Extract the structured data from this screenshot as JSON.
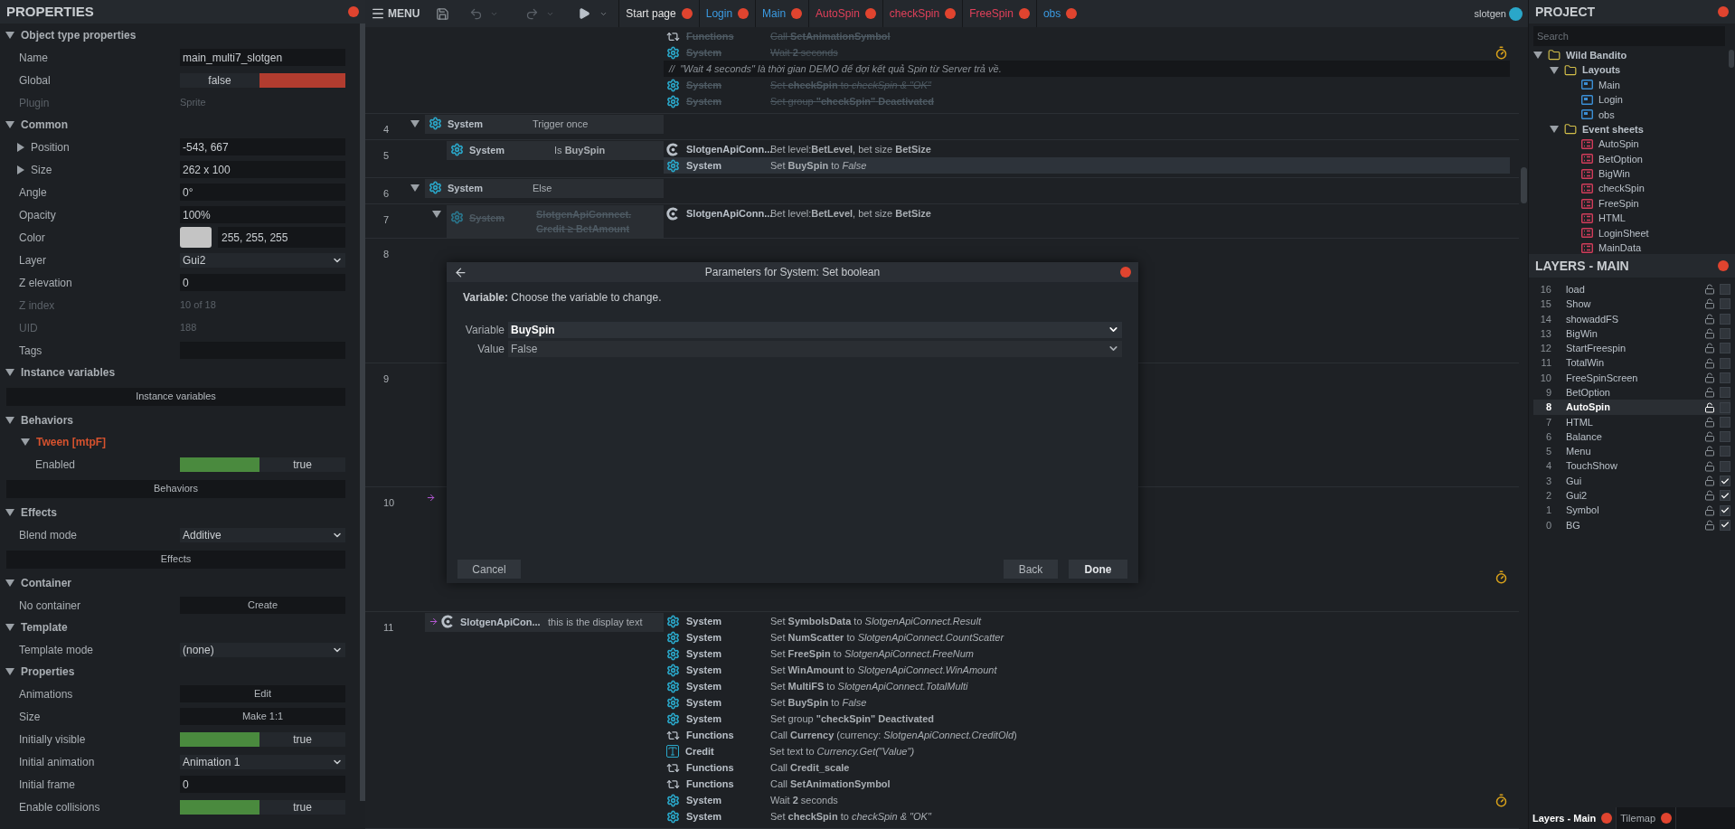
{
  "properties": {
    "title": "PROPERTIES",
    "sections": [
      {
        "title": "Object type properties",
        "expanded": true,
        "rows": [
          {
            "kind": "text",
            "label": "Name",
            "value": "main_multi7_slotgen"
          },
          {
            "kind": "toggle",
            "label": "Global",
            "value": "false",
            "on": false
          },
          {
            "kind": "info",
            "label": "Plugin",
            "value": "Sprite"
          }
        ]
      },
      {
        "title": "Common",
        "expanded": true,
        "rows": [
          {
            "kind": "text",
            "label": "Position",
            "value": "-543, 667",
            "expanded": false
          },
          {
            "kind": "text",
            "label": "Size",
            "value": "262 x 100",
            "expanded": false
          },
          {
            "kind": "text",
            "label": "Angle",
            "value": "0°"
          },
          {
            "kind": "text",
            "label": "Opacity",
            "value": "100%"
          },
          {
            "kind": "color",
            "label": "Color",
            "value": "255, 255, 255"
          },
          {
            "kind": "select",
            "label": "Layer",
            "value": "Gui2"
          },
          {
            "kind": "text",
            "label": "Z elevation",
            "value": "0"
          },
          {
            "kind": "info",
            "label": "Z index",
            "value": "10 of 18"
          },
          {
            "kind": "info",
            "label": "UID",
            "value": "188"
          },
          {
            "kind": "text",
            "label": "Tags"
          }
        ]
      },
      {
        "title": "Instance variables",
        "expanded": true,
        "rows": [
          {
            "kind": "wide_button",
            "label": "Instance variables"
          }
        ]
      },
      {
        "title": "Behaviors",
        "expanded": true,
        "rows": [
          {
            "kind": "behavior",
            "label": "Tween [mtpF]",
            "expanded": true,
            "children": [
              {
                "kind": "toggle",
                "label": "Enabled",
                "value": "true",
                "on": true
              }
            ]
          },
          {
            "kind": "wide_button",
            "label": "Behaviors"
          }
        ]
      },
      {
        "title": "Effects",
        "expanded": true,
        "rows": [
          {
            "kind": "select",
            "label": "Blend mode",
            "value": "Additive"
          },
          {
            "kind": "wide_button",
            "label": "Effects"
          }
        ]
      },
      {
        "title": "Container",
        "expanded": true,
        "rows": [
          {
            "kind": "action",
            "label": "No container",
            "button": "Create"
          }
        ]
      },
      {
        "title": "Template",
        "expanded": true,
        "rows": [
          {
            "kind": "select",
            "label": "Template mode",
            "value": "(none)"
          }
        ]
      },
      {
        "title": "Properties",
        "expanded": true,
        "rows": [
          {
            "kind": "action",
            "label": "Animations",
            "button": "Edit"
          },
          {
            "kind": "action",
            "label": "Size",
            "button": "Make 1:1"
          },
          {
            "kind": "toggle",
            "label": "Initially visible",
            "value": "true",
            "on": true
          },
          {
            "kind": "select",
            "label": "Initial animation",
            "value": "Animation 1"
          },
          {
            "kind": "text",
            "label": "Initial frame",
            "value": "0"
          },
          {
            "kind": "toggle",
            "label": "Enable collisions",
            "value": "true",
            "on": true
          }
        ]
      }
    ]
  },
  "toolbar": {
    "menu": "MENU"
  },
  "tabs": [
    {
      "label": "Start page",
      "color": "#e6e6e6"
    },
    {
      "label": "Login",
      "color": "#3b9ae1"
    },
    {
      "label": "Main",
      "color": "#3b9ae1"
    },
    {
      "label": "AutoSpin",
      "color": "#e0405a"
    },
    {
      "label": "checkSpin",
      "color": "#e0405a"
    },
    {
      "label": "FreeSpin",
      "color": "#e0405a"
    },
    {
      "label": "obs",
      "color": "#3b9ae1"
    }
  ],
  "user": {
    "name": "slotgen"
  },
  "event_sheet": {
    "events": [
      {
        "actions": [
          {
            "kind": "functions",
            "object": "Functions",
            "text": "Call **SetAnimationSymbol**",
            "disabled": true
          },
          {
            "kind": "system",
            "object": "System",
            "text": "Wait **2** seconds",
            "disabled": true,
            "wait": true
          },
          {
            "kind": "comment",
            "marker": "//",
            "text": "\"Wait 4 seconds\" là thời gian DEMO để đợi kết quả Spin từ Server trả về."
          },
          {
            "kind": "system",
            "object": "System",
            "text": "Set **checkSpin** to *checkSpin & \"OK\"*",
            "disabled": true
          },
          {
            "kind": "system",
            "object": "System",
            "text": "Set group **\"checkSpin\"** **Deactivated**",
            "disabled": true
          }
        ]
      },
      {
        "number": "4",
        "expanded": true,
        "conditions": [
          {
            "kind": "system",
            "object": "System",
            "text": "Trigger once",
            "disabled": false
          }
        ],
        "children": [
          {
            "number": "5",
            "conditions": [
              {
                "kind": "system",
                "object": "System",
                "text": "Is **BuySpin**",
                "disabled": false
              }
            ],
            "actions": [
              {
                "kind": "slotgen",
                "object": "SlotgenApiConn...",
                "text": "Bet level:**BetLevel**, bet size **BetSize**",
                "disabled": false,
                "selected": false
              },
              {
                "kind": "system",
                "object": "System",
                "text": "Set **BuySpin** to *False*",
                "disabled": false,
                "selected": true
              }
            ]
          }
        ]
      },
      {
        "number": "6",
        "expanded": true,
        "conditions": [
          {
            "kind": "system",
            "object": "System",
            "text": "Else",
            "disabled": false
          }
        ],
        "children": [
          {
            "number": "7",
            "expanded": true,
            "conditions": [
              {
                "kind": "system",
                "object": "System",
                "text": "SlotgenApiConnect. Credit ≥ BetAmount",
                "disabled": true
              }
            ],
            "actions": [
              {
                "kind": "slotgen",
                "object": "SlotgenApiConn...",
                "text": "Bet level:**BetLevel**, bet size **BetSize**",
                "disabled": false
              }
            ]
          }
        ]
      },
      {
        "number": "8"
      },
      {
        "number": "9"
      },
      {
        "number": "10",
        "trigger": true,
        "wait": true
      },
      {
        "number": "11",
        "trigger": true,
        "conditions": [
          {
            "kind": "slotgen",
            "object": "SlotgenApiCon...",
            "text": "this is the display text",
            "disabled": false
          }
        ],
        "actions": [
          {
            "kind": "system",
            "object": "System",
            "text": "Set **SymbolsData** to *SlotgenApiConnect.Result*",
            "disabled": false
          },
          {
            "kind": "system",
            "object": "System",
            "text": "Set **NumScatter** to *SlotgenApiConnect.CountScatter*",
            "disabled": false
          },
          {
            "kind": "system",
            "object": "System",
            "text": "Set **FreeSpin** to *SlotgenApiConnect.FreeNum*",
            "disabled": false
          },
          {
            "kind": "system",
            "object": "System",
            "text": "Set **WinAmount** to *SlotgenApiConnect.WinAmount*",
            "disabled": false
          },
          {
            "kind": "system",
            "object": "System",
            "text": "Set **MultiFS** to *SlotgenApiConnect.TotalMulti*",
            "disabled": false
          },
          {
            "kind": "system",
            "object": "System",
            "text": "Set **BuySpin** to *False*",
            "disabled": false
          },
          {
            "kind": "system",
            "object": "System",
            "text": "Set group **\"checkSpin\"** **Deactivated**",
            "disabled": false
          },
          {
            "kind": "functions",
            "object": "Functions",
            "text": "Call **Currency** (currency: *SlotgenApiConnect.CreditOld*)",
            "disabled": false
          },
          {
            "kind": "text",
            "object": "Credit",
            "text": "Set text to *Currency.Get(\"Value\")*",
            "disabled": false
          },
          {
            "kind": "functions",
            "object": "Functions",
            "text": "Call **Credit_scale**",
            "disabled": false
          },
          {
            "kind": "functions",
            "object": "Functions",
            "text": "Call **SetAnimationSymbol**",
            "disabled": false
          },
          {
            "kind": "system",
            "object": "System",
            "text": "Wait **2** seconds",
            "disabled": false,
            "wait": true
          },
          {
            "kind": "system",
            "object": "System",
            "text": "Set **checkSpin** to *checkSpin & \"OK\"*",
            "disabled": false
          }
        ]
      }
    ]
  },
  "dialog": {
    "title": "Parameters for System: Set boolean",
    "description": "**Variable:** Choose the variable to change.",
    "fields": [
      {
        "label": "Variable",
        "value": "BuySpin",
        "focused": true
      },
      {
        "label": "Value",
        "value": "False",
        "focused": false
      }
    ],
    "buttons": [
      {
        "label": "Cancel",
        "default": false
      },
      {
        "label": "Back",
        "default": false
      },
      {
        "label": "Done",
        "default": true
      }
    ]
  },
  "project": {
    "title": "PROJECT",
    "search": {
      "placeholder": "Search"
    },
    "tree": [
      {
        "label": "Wild Bandito",
        "kind": "folder",
        "expanded": true,
        "children": [
          {
            "label": "Layouts",
            "kind": "folder",
            "expanded": true,
            "children": [
              {
                "label": "Main",
                "kind": "layout"
              },
              {
                "label": "Login",
                "kind": "layout"
              },
              {
                "label": "obs",
                "kind": "layout"
              }
            ]
          },
          {
            "label": "Event sheets",
            "kind": "folder",
            "expanded": true,
            "children": [
              {
                "label": "AutoSpin",
                "kind": "sheet"
              },
              {
                "label": "BetOption",
                "kind": "sheet"
              },
              {
                "label": "BigWin",
                "kind": "sheet"
              },
              {
                "label": "checkSpin",
                "kind": "sheet"
              },
              {
                "label": "FreeSpin",
                "kind": "sheet"
              },
              {
                "label": "HTML",
                "kind": "sheet"
              },
              {
                "label": "LoginSheet",
                "kind": "sheet"
              },
              {
                "label": "MainData",
                "kind": "sheet"
              }
            ]
          }
        ]
      }
    ]
  },
  "layers": {
    "title": "LAYERS - MAIN",
    "items": [
      {
        "number": "16",
        "label": "load",
        "checked": false,
        "selected": false
      },
      {
        "number": "15",
        "label": "Show",
        "checked": false,
        "selected": false
      },
      {
        "number": "14",
        "label": "showaddFS",
        "checked": false,
        "selected": false
      },
      {
        "number": "13",
        "label": "BigWin",
        "checked": false,
        "selected": false
      },
      {
        "number": "12",
        "label": "StartFreespin",
        "checked": false,
        "selected": false
      },
      {
        "number": "11",
        "label": "TotalWin",
        "checked": false,
        "selected": false
      },
      {
        "number": "10",
        "label": "FreeSpinScreen",
        "checked": false,
        "selected": false
      },
      {
        "number": "9",
        "label": "BetOption",
        "checked": false,
        "selected": false
      },
      {
        "number": "8",
        "label": "AutoSpin",
        "checked": false,
        "selected": true
      },
      {
        "number": "7",
        "label": "HTML",
        "checked": false,
        "selected": false
      },
      {
        "number": "6",
        "label": "Balance",
        "checked": false,
        "selected": false
      },
      {
        "number": "5",
        "label": "Menu",
        "checked": false,
        "selected": false
      },
      {
        "number": "4",
        "label": "TouchShow",
        "checked": false,
        "selected": false
      },
      {
        "number": "3",
        "label": "Gui",
        "checked": true,
        "selected": false
      },
      {
        "number": "2",
        "label": "Gui2",
        "checked": true,
        "selected": false
      },
      {
        "number": "1",
        "label": "Symbol",
        "checked": true,
        "selected": false
      },
      {
        "number": "0",
        "label": "BG",
        "checked": true,
        "selected": false
      }
    ]
  },
  "bottom_tabs": [
    {
      "label": "Layers - Main",
      "selected": true
    },
    {
      "label": "Tilemap",
      "selected": false
    }
  ]
}
